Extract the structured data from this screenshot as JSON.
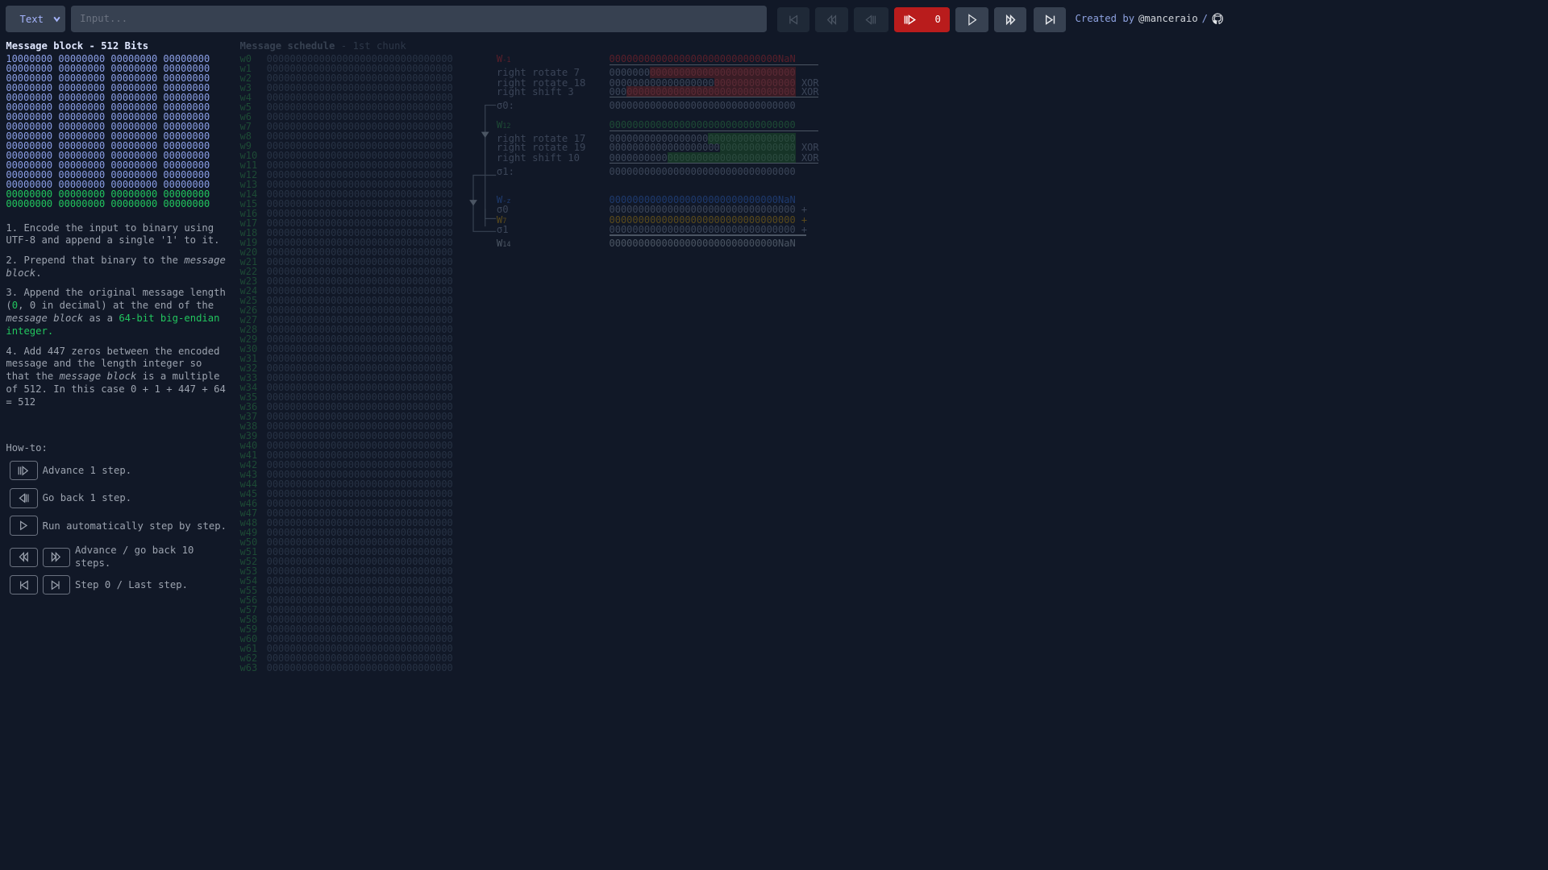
{
  "toolbar": {
    "mode_select": "Text",
    "input_placeholder": "Input...",
    "step_counter": "0",
    "credit_prefix": "Created by",
    "credit_handle": "@manceraio",
    "credit_sep": "/",
    "buttons": [
      "step-0",
      "back-10",
      "back-1",
      "advance-1",
      "play",
      "forward-10",
      "last-step"
    ],
    "disabled": [
      "step-0",
      "back-10",
      "back-1"
    ]
  },
  "message_block": {
    "title": "Message block - 512 Bits",
    "rows": [
      "10000000 00000000 00000000 00000000",
      "00000000 00000000 00000000 00000000",
      "00000000 00000000 00000000 00000000",
      "00000000 00000000 00000000 00000000",
      "00000000 00000000 00000000 00000000",
      "00000000 00000000 00000000 00000000",
      "00000000 00000000 00000000 00000000",
      "00000000 00000000 00000000 00000000",
      "00000000 00000000 00000000 00000000",
      "00000000 00000000 00000000 00000000",
      "00000000 00000000 00000000 00000000",
      "00000000 00000000 00000000 00000000",
      "00000000 00000000 00000000 00000000",
      "00000000 00000000 00000000 00000000"
    ],
    "length_rows": [
      "00000000 00000000 00000000 00000000",
      "00000000 00000000 00000000 00000000"
    ]
  },
  "steps": {
    "s1": "1. Encode the input to binary using UTF-8 and append a single '1' to it.",
    "s2a": "2. Prepend that binary to the ",
    "s2b": "message block",
    "s2c": ".",
    "s3a": "3. Append the original message length (",
    "s3b": "0",
    "s3c": ", 0 in decimal) at the end of the ",
    "s3d": "message block",
    "s3e": " as a ",
    "s3f": "64-bit big-endian integer.",
    "s4a": "4. Add 447 zeros between the encoded message and the length integer so that the ",
    "s4b": "message block",
    "s4c": " is a multiple of 512. In this case 0 + 1 + 447 + 64 = 512"
  },
  "howto": {
    "title": "How-to:",
    "advance": "Advance 1 step.",
    "back": "Go back 1 step.",
    "run": "Run automatically step by step.",
    "ten": "Advance / go back 10 steps.",
    "ends": "Step 0 / Last step."
  },
  "schedule": {
    "title": "Message schedule",
    "subtitle": " - 1st chunk",
    "value": "00000000000000000000000000000000",
    "labels": [
      "w0",
      "w1",
      "w2",
      "w3",
      "w4",
      "w5",
      "w6",
      "w7",
      "w8",
      "w9",
      "w10",
      "w11",
      "w12",
      "w13",
      "w14",
      "w15",
      "w16",
      "w17",
      "w18",
      "w19",
      "w20",
      "w21",
      "w22",
      "w23",
      "w24",
      "w25",
      "w26",
      "w27",
      "w28",
      "w29",
      "w30",
      "w31",
      "w32",
      "w33",
      "w34",
      "w35",
      "w36",
      "w37",
      "w38",
      "w39",
      "w40",
      "w41",
      "w42",
      "w43",
      "w44",
      "w45",
      "w46",
      "w47",
      "w48",
      "w49",
      "w50",
      "w51",
      "w52",
      "w53",
      "w54",
      "w55",
      "w56",
      "w57",
      "w58",
      "w59",
      "w60",
      "w61",
      "w62",
      "w63"
    ]
  },
  "calc": {
    "w_m15": {
      "label": "W",
      "sub": "-1",
      "value": "00000000000000000000000000000NaN"
    },
    "rr7": {
      "label": "right rotate 7",
      "plain": "0000000",
      "hl": "0000000000000000000000000",
      "op": ""
    },
    "rr18": {
      "label": "right rotate 18",
      "plain": "000000000000000000",
      "hl": "00000000000000",
      "op": "XOR"
    },
    "rs3": {
      "label": "right shift 3",
      "plain": "000",
      "hl": "00000000000000000000000000000",
      "op": "XOR"
    },
    "sigma0": {
      "label": "σ0:",
      "value": "00000000000000000000000000000000"
    },
    "w_m2": {
      "label": "W",
      "sub": "12",
      "value": "00000000000000000000000000000000"
    },
    "rr17": {
      "label": "right rotate 17",
      "plain": "00000000000000000",
      "hl": "000000000000000",
      "op": ""
    },
    "rr19": {
      "label": "right rotate 19",
      "plain": "0000000000000000000",
      "hl": "0000000000000",
      "op": "XOR"
    },
    "rs10": {
      "label": "right shift 10",
      "plain": "0000000000",
      "hl": "0000000000000000000000",
      "op": "XOR"
    },
    "sigma1": {
      "label": "σ1:",
      "value": "00000000000000000000000000000000"
    },
    "sum": [
      {
        "label": "W",
        "sub": "-z",
        "value": "00000000000000000000000000000NaN",
        "op": "",
        "color": "#1e3a6e"
      },
      {
        "label": "σ0",
        "sub": "",
        "value": "00000000000000000000000000000000",
        "op": "+",
        "color": "#3b4558"
      },
      {
        "label": "W",
        "sub": "7",
        "value": "00000000000000000000000000000000",
        "op": "+",
        "color": "#5a4a1c"
      },
      {
        "label": "σ1",
        "sub": "",
        "value": "00000000000000000000000000000000",
        "op": "+",
        "color": "#3b4558"
      }
    ],
    "result": {
      "label": "W",
      "sub": "14",
      "value": "00000000000000000000000000000NaN"
    }
  },
  "colors": {
    "background": "#111827",
    "accent_red": "#b91c1c",
    "green": "#22c55e",
    "bits": "#8b9fe6"
  }
}
